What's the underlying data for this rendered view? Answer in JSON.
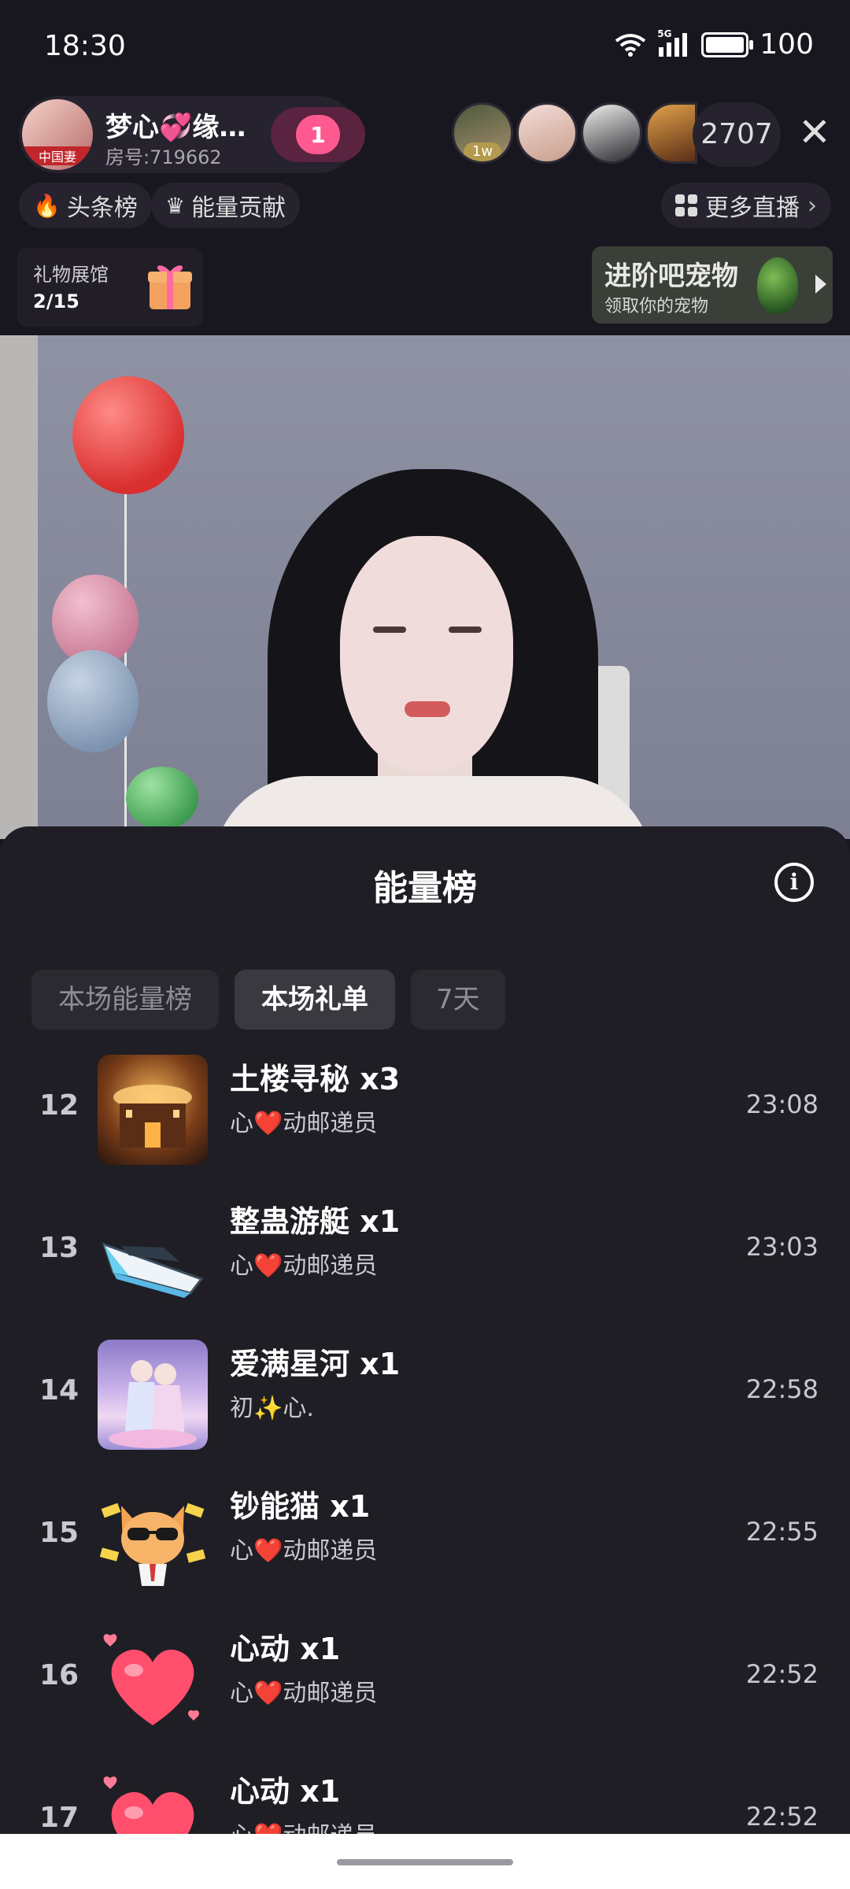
{
  "status_bar": {
    "time": "18:30",
    "network": "5G",
    "battery": "100",
    "battery_level": 1.0
  },
  "header": {
    "host_name": "梦心💞缘…",
    "room_no": "房号:719662",
    "host_avatar_tag": "中国妻",
    "fan_level": "1",
    "viewer_badge": "1w",
    "viewer_count": "2707",
    "close_label": "✕",
    "chips": {
      "headline": "头条榜",
      "energy": "能量贡献",
      "more_live": "更多直播"
    },
    "gift_hall": {
      "title": "礼物展馆",
      "progress": "2/15"
    },
    "pet_banner": {
      "title": "进阶吧宠物",
      "subtitle": "领取你的宠物"
    }
  },
  "sheet": {
    "title": "能量榜",
    "info_icon": "i",
    "tabs": [
      {
        "label": "本场能量榜",
        "active": false
      },
      {
        "label": "本场礼单",
        "active": true
      },
      {
        "label": "7天",
        "active": false
      }
    ],
    "rows": [
      {
        "rank": "12",
        "gift": "土楼寻秘  x3",
        "sender": "心❤️动邮递员",
        "time": "23:08",
        "thumb": "tulou"
      },
      {
        "rank": "13",
        "gift": "整蛊游艇  x1",
        "sender": "心❤️动邮递员",
        "time": "23:03",
        "thumb": "yacht"
      },
      {
        "rank": "14",
        "gift": "爱满星河  x1",
        "sender": "初✨心.",
        "time": "22:58",
        "thumb": "couple"
      },
      {
        "rank": "15",
        "gift": "钞能猫  x1",
        "sender": "心❤️动邮递员",
        "time": "22:55",
        "thumb": "cat"
      },
      {
        "rank": "16",
        "gift": "心动  x1",
        "sender": "心❤️动邮递员",
        "time": "22:52",
        "thumb": "heart"
      },
      {
        "rank": "17",
        "gift": "心动  x1",
        "sender": "心❤️动邮递员",
        "time": "22:52",
        "thumb": "heart"
      }
    ]
  },
  "colors": {
    "background": "#18161f",
    "sheet": "#1f1e24",
    "accent_pink": "#ff5a90"
  }
}
